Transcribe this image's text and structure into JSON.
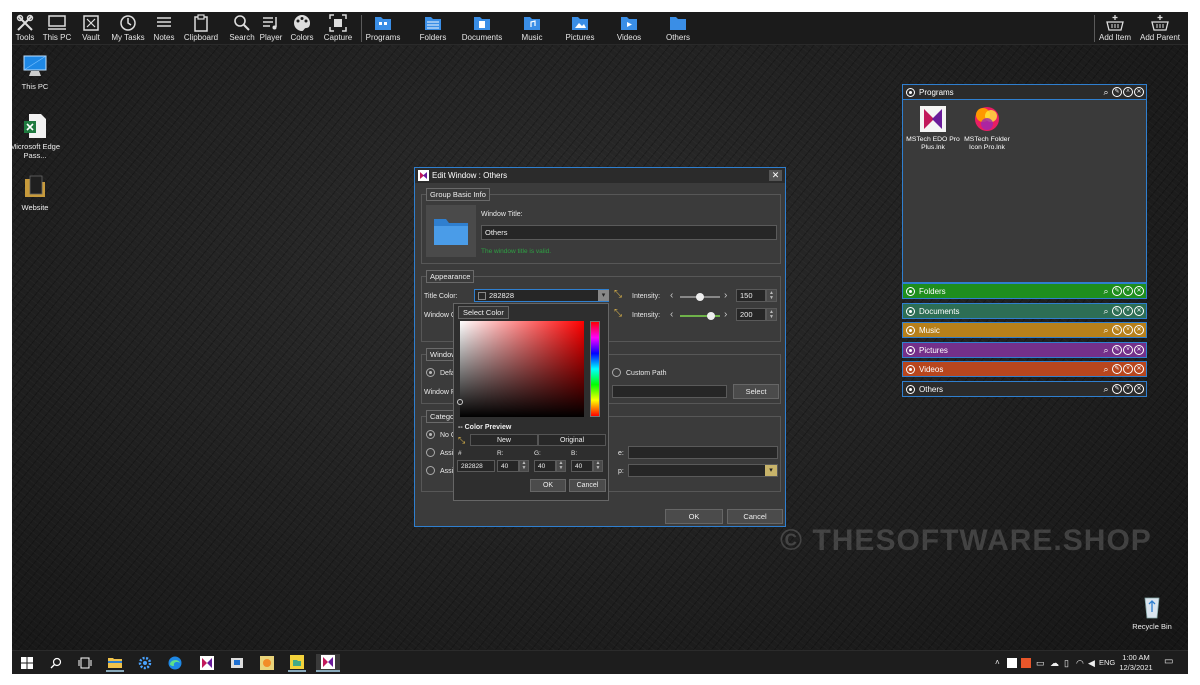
{
  "toolbar": {
    "tools": [
      {
        "label": "Tools",
        "icon": "tools-icon"
      },
      {
        "label": "This PC",
        "icon": "monitor-icon"
      },
      {
        "label": "Vault",
        "icon": "vault-icon"
      },
      {
        "label": "My Tasks",
        "icon": "clock-icon"
      },
      {
        "label": "Notes",
        "icon": "notes-icon"
      },
      {
        "label": "Clipboard",
        "icon": "clipboard-icon"
      },
      {
        "label": "Search",
        "icon": "search-icon"
      },
      {
        "label": "Player",
        "icon": "player-icon"
      },
      {
        "label": "Colors",
        "icon": "palette-icon"
      },
      {
        "label": "Capture",
        "icon": "capture-icon"
      }
    ],
    "folders": [
      {
        "label": "Programs"
      },
      {
        "label": "Folders"
      },
      {
        "label": "Documents"
      },
      {
        "label": "Music"
      },
      {
        "label": "Pictures"
      },
      {
        "label": "Videos"
      },
      {
        "label": "Others"
      }
    ],
    "add_item": "Add Item",
    "add_parent": "Add Parent"
  },
  "desktop": {
    "icons": [
      {
        "label": "This PC"
      },
      {
        "label": "Microsoft Edge Pass..."
      },
      {
        "label": "Website"
      },
      {
        "label": "Recycle Bin"
      }
    ]
  },
  "watermark": "© THESOFTWARE.SHOP",
  "groups": [
    {
      "title": "Programs",
      "color": "#2b2b2b",
      "items": [
        {
          "label": "MSTech EDO Pro Plus.lnk"
        },
        {
          "label": "MSTech Folder Icon Pro.lnk"
        }
      ]
    },
    {
      "title": "Folders",
      "color": "#1e8e1e"
    },
    {
      "title": "Documents",
      "color": "#2d6e55"
    },
    {
      "title": "Music",
      "color": "#b7801a"
    },
    {
      "title": "Pictures",
      "color": "#74308a"
    },
    {
      "title": "Videos",
      "color": "#b8461e"
    },
    {
      "title": "Others",
      "color": "#2b2b2b"
    }
  ],
  "edit_window": {
    "title": "Edit Window : Others",
    "basic_info": {
      "legend": "Group Basic Info",
      "window_title_label": "Window Title:",
      "window_title_value": "Others",
      "hint": "The window title is valid."
    },
    "appearance": {
      "legend": "Appearance",
      "title_color_label": "Title Color:",
      "title_color_value": "282828",
      "window_color_label": "Window Co",
      "intensity_label": "Intensity:",
      "intensity_1": "150",
      "intensity_2": "200",
      "intensity_1_fraction": 0.5,
      "intensity_2_fraction": 0.78
    },
    "window_path": {
      "legend": "Window",
      "default_label": "Defa",
      "custom_label": "Custom Path",
      "path_label": "Window Pa",
      "select_button": "Select"
    },
    "category": {
      "legend": "Categor",
      "no_label": "No C",
      "assign1": "Assi",
      "assign2": "Assi",
      "field1_label": "e:",
      "field2_label": "p:"
    },
    "ok": "OK",
    "cancel": "Cancel"
  },
  "picker": {
    "title": "Select Color",
    "preview_label": "Color Preview",
    "new_label": "New",
    "original_label": "Original",
    "hash_label": "#",
    "r_label": "R:",
    "g_label": "G:",
    "b_label": "B:",
    "hex": "282828",
    "r": "40",
    "g": "40",
    "b": "40",
    "ok": "OK",
    "cancel": "Cancel"
  },
  "taskbar": {
    "lang": "ENG",
    "time": "1:00 AM",
    "date": "12/3/2021"
  }
}
